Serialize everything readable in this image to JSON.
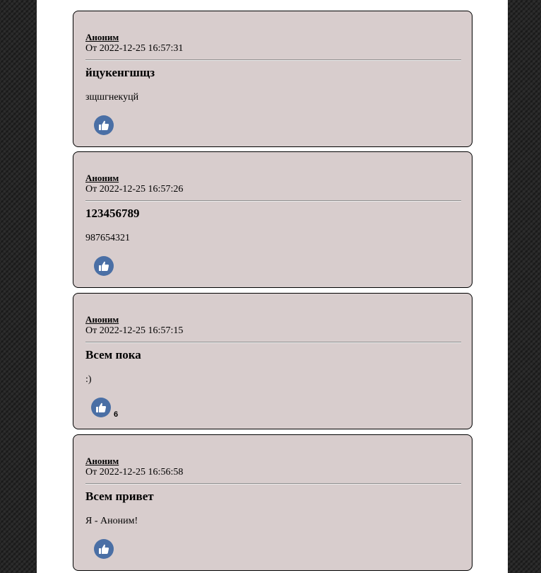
{
  "posts": [
    {
      "author": "Аноним",
      "date": "От 2022-12-25 16:57:31",
      "title": "йцукенгшщз",
      "body": "зщшгнекуцй",
      "likes": ""
    },
    {
      "author": "Аноним",
      "date": "От 2022-12-25 16:57:26",
      "title": "123456789",
      "body": "987654321",
      "likes": ""
    },
    {
      "author": "Аноним",
      "date": "От 2022-12-25 16:57:15",
      "title": "Всем пока",
      "body": ":)",
      "likes": "6"
    },
    {
      "author": "Аноним",
      "date": "От 2022-12-25 16:56:58",
      "title": "Всем привет",
      "body": "Я - Аноним!",
      "likes": ""
    }
  ],
  "colors": {
    "post_background": "#d8cdcd",
    "like_button": "#4a6fa5",
    "page_background": "#ffffff"
  },
  "icons": {
    "like": "thumbs-up-icon"
  }
}
